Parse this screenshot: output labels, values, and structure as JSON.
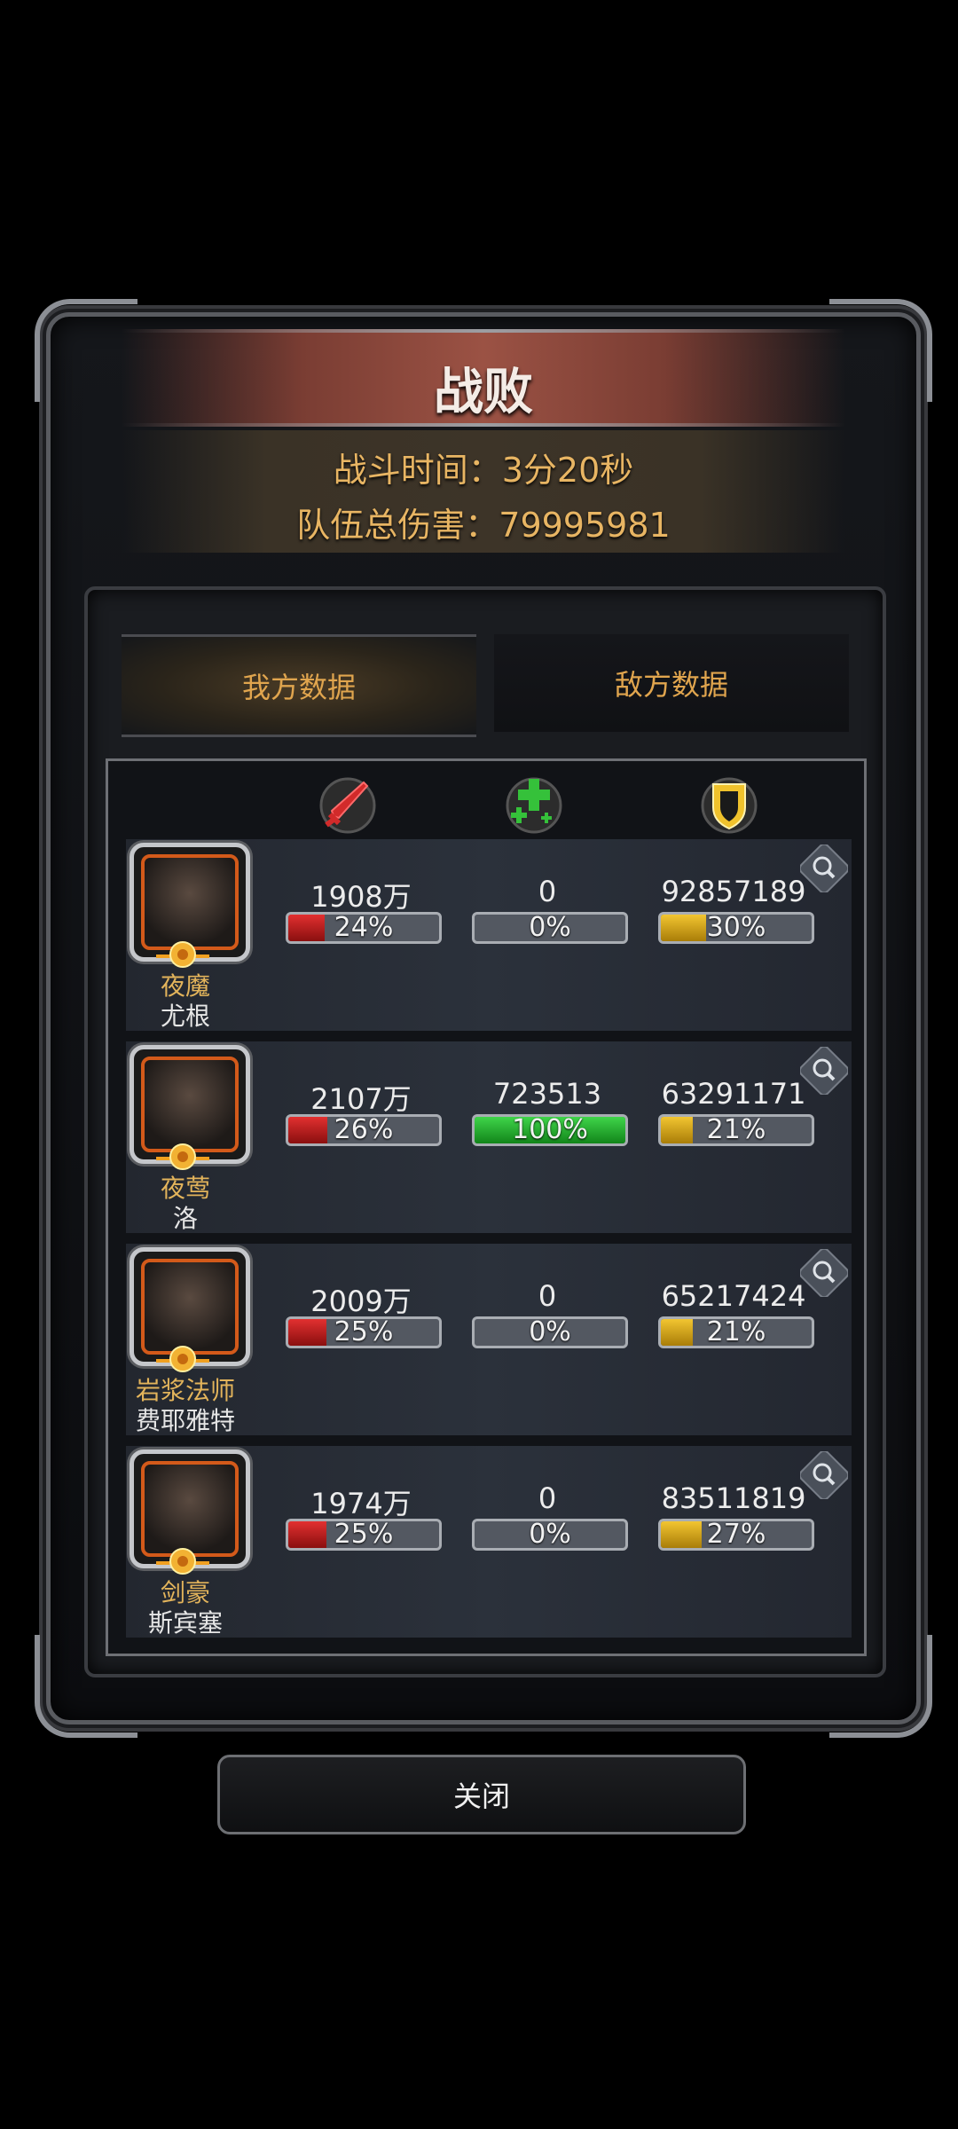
{
  "title": "战败",
  "battle_time": "战斗时间：3分20秒",
  "team_damage": "队伍总伤害：79995981",
  "tabs": {
    "ours": "我方数据",
    "enemy": "敌方数据"
  },
  "columns": [
    {
      "icon": "sword-icon",
      "color": "#d22a2a"
    },
    {
      "icon": "heal-cross-icon",
      "color": "#35c13a"
    },
    {
      "icon": "shield-icon",
      "color": "#f0c22c"
    }
  ],
  "heroes": [
    {
      "hero": "夜魔",
      "player": "尤根",
      "damage": "1908万",
      "damage_pct": "24%",
      "damage_ratio": 0.24,
      "heal": "0",
      "heal_pct": "0%",
      "heal_ratio": 0,
      "tank": "92857189",
      "tank_pct": "30%",
      "tank_ratio": 0.3
    },
    {
      "hero": "夜莺",
      "player": "洛",
      "damage": "2107万",
      "damage_pct": "26%",
      "damage_ratio": 0.26,
      "heal": "723513",
      "heal_pct": "100%",
      "heal_ratio": 1.0,
      "tank": "63291171",
      "tank_pct": "21%",
      "tank_ratio": 0.21
    },
    {
      "hero": "岩浆法师",
      "player": "费耶雅特",
      "damage": "2009万",
      "damage_pct": "25%",
      "damage_ratio": 0.25,
      "heal": "0",
      "heal_pct": "0%",
      "heal_ratio": 0,
      "tank": "65217424",
      "tank_pct": "21%",
      "tank_ratio": 0.21
    },
    {
      "hero": "剑豪",
      "player": "斯宾塞",
      "damage": "1974万",
      "damage_pct": "25%",
      "damage_ratio": 0.25,
      "heal": "0",
      "heal_pct": "0%",
      "heal_ratio": 0,
      "tank": "83511819",
      "tank_pct": "27%",
      "tank_ratio": 0.27
    }
  ],
  "close_label": "关闭"
}
